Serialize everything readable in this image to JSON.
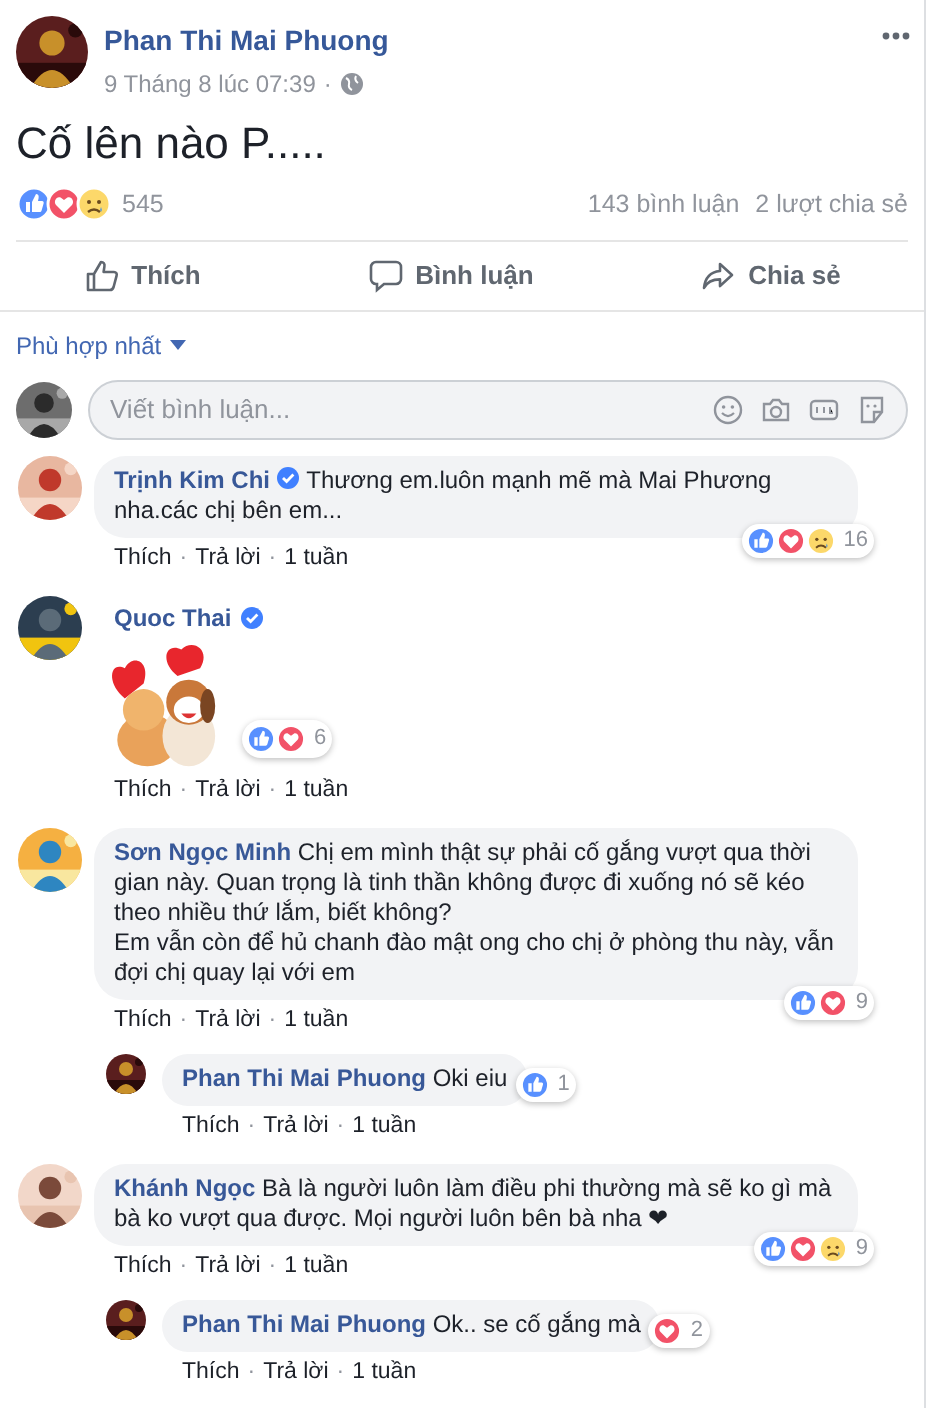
{
  "post": {
    "author": "Phan Thi Mai Phuong",
    "date": "9 Tháng 8 lúc 07:39",
    "date_separator": "·",
    "text": "Cố lên nào P.....",
    "reactions": [
      {
        "kind": "like"
      },
      {
        "kind": "love"
      },
      {
        "kind": "sad"
      }
    ],
    "reaction_count": "545",
    "comments_count": "143 bình luận",
    "shares_count": "2 lượt chia sẻ",
    "actions": [
      {
        "kind": "like",
        "label": "Thích"
      },
      {
        "kind": "comment",
        "label": "Bình luận"
      },
      {
        "kind": "share",
        "label": "Chia sẻ"
      }
    ]
  },
  "sort": {
    "label": "Phù hợp nhất"
  },
  "composer": {
    "placeholder": "Viết bình luận..."
  },
  "comments": [
    {
      "kind": "text",
      "author": "Trịnh Kim Chi",
      "verified": true,
      "text": "Thương em.luôn mạnh mẽ mà Mai Phương nha.các chị bên em...",
      "reactions": [
        {
          "kind": "like"
        },
        {
          "kind": "love"
        },
        {
          "kind": "sad"
        }
      ],
      "reaction_count": "16",
      "meta": [
        {
          "kind": "link",
          "label": "Thích"
        },
        {
          "kind": "dot",
          "label": "·"
        },
        {
          "kind": "link",
          "label": "Trả lời"
        },
        {
          "kind": "dot",
          "label": "·"
        },
        {
          "kind": "time",
          "label": "1 tuần"
        }
      ]
    },
    {
      "kind": "sticker",
      "author": "Quoc Thai",
      "verified": true,
      "reactions": [
        {
          "kind": "like"
        },
        {
          "kind": "love"
        }
      ],
      "reaction_count": "6",
      "meta": [
        {
          "kind": "link",
          "label": "Thích"
        },
        {
          "kind": "dot",
          "label": "·"
        },
        {
          "kind": "link",
          "label": "Trả lời"
        },
        {
          "kind": "dot",
          "label": "·"
        },
        {
          "kind": "time",
          "label": "1 tuần"
        }
      ]
    },
    {
      "kind": "text",
      "author": "Sơn Ngọc Minh",
      "verified": false,
      "text": "Chị em mình thật sự phải cố gắng vượt qua thời gian này. Quan trọng là tinh thần không được đi xuống nó sẽ kéo theo nhiều thứ lắm, biết không?\nEm vẫn còn để hủ chanh đào mật ong cho chị ở phòng thu này, vẫn đợi chị quay lại với em",
      "reactions": [
        {
          "kind": "like"
        },
        {
          "kind": "love"
        }
      ],
      "reaction_count": "9",
      "meta": [
        {
          "kind": "link",
          "label": "Thích"
        },
        {
          "kind": "dot",
          "label": "·"
        },
        {
          "kind": "link",
          "label": "Trả lời"
        },
        {
          "kind": "dot",
          "label": "·"
        },
        {
          "kind": "time",
          "label": "1 tuần"
        }
      ],
      "replies": [
        {
          "kind": "text",
          "author": "Phan Thi Mai Phuong",
          "verified": false,
          "text": "Oki eiu",
          "reactions": [
            {
              "kind": "like"
            }
          ],
          "reaction_count": "1",
          "meta": [
            {
              "kind": "link",
              "label": "Thích"
            },
            {
              "kind": "dot",
              "label": "·"
            },
            {
              "kind": "link",
              "label": "Trả lời"
            },
            {
              "kind": "dot",
              "label": "·"
            },
            {
              "kind": "time",
              "label": "1 tuần"
            }
          ]
        }
      ]
    },
    {
      "kind": "text",
      "author": "Khánh Ngọc",
      "verified": false,
      "text": "Bà là người luôn làm điều phi thường mà sẽ ko gì mà bà ko vượt qua được. Mọi người luôn bên bà nha ❤",
      "reactions": [
        {
          "kind": "like"
        },
        {
          "kind": "love"
        },
        {
          "kind": "sad"
        }
      ],
      "reaction_count": "9",
      "meta": [
        {
          "kind": "link",
          "label": "Thích"
        },
        {
          "kind": "dot",
          "label": "·"
        },
        {
          "kind": "link",
          "label": "Trả lời"
        },
        {
          "kind": "dot",
          "label": "·"
        },
        {
          "kind": "time",
          "label": "1 tuần"
        }
      ],
      "replies": [
        {
          "kind": "text",
          "author": "Phan Thi Mai Phuong",
          "verified": false,
          "text": "Ok.. se cố gắng mà",
          "reactions": [
            {
              "kind": "love"
            }
          ],
          "reaction_count": "2",
          "meta": [
            {
              "kind": "link",
              "label": "Thích"
            },
            {
              "kind": "dot",
              "label": "·"
            },
            {
              "kind": "link",
              "label": "Trả lời"
            },
            {
              "kind": "dot",
              "label": "·"
            },
            {
              "kind": "time",
              "label": "1 tuần"
            }
          ]
        }
      ]
    }
  ]
}
